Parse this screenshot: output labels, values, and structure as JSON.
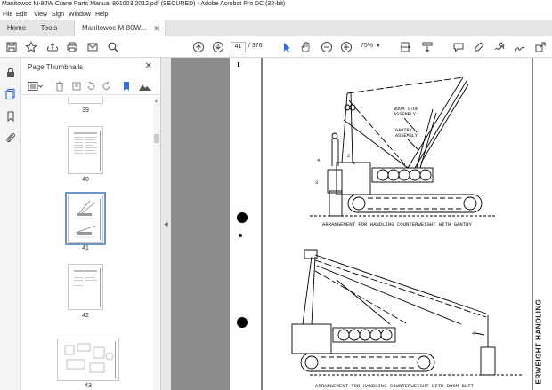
{
  "window": {
    "title": "Manitowoc M-80W Crane Parts Manual 801003 2012.pdf (SECURED) - Adobe Acrobat Pro DC (32-bit)"
  },
  "menu": [
    "File",
    "Edit",
    "View",
    "Sign",
    "Window",
    "Help"
  ],
  "tabs": {
    "home": "Home",
    "tools": "Tools",
    "document": "Manitowoc M-80W..."
  },
  "toolbar": {
    "current_page": "41",
    "total_pages": "/ 376",
    "zoom": "75%"
  },
  "thumbnails": {
    "panel_title": "Page Thumbnails",
    "pages": [
      {
        "label": "39"
      },
      {
        "label": "40"
      },
      {
        "label": "41",
        "selected": true
      },
      {
        "label": "42"
      },
      {
        "label": "43"
      }
    ]
  },
  "document": {
    "caption_top": "ARRANGEMENT FOR HANDLING COUNTERWEIGHT WITH GANTRY",
    "caption_bottom": "ARRANGEMENT FOR HANDLING COUNTERWEIGHT WITH BOOM BUTT",
    "label_boom_stop": "BOOM STOP\nASSEMBLY",
    "label_gantry": "GANTRY\nASSEMBLY",
    "callout_1": "1",
    "callout_2": "2",
    "callout_3": "3",
    "callout_4": "4",
    "callout_4b": "4",
    "side_heading": "ERWEIGHT HANDLING"
  },
  "colors": {
    "accent": "#2f6fd6",
    "doc_background": "#8d8d8d",
    "selected_outline": "#6f95c8"
  }
}
